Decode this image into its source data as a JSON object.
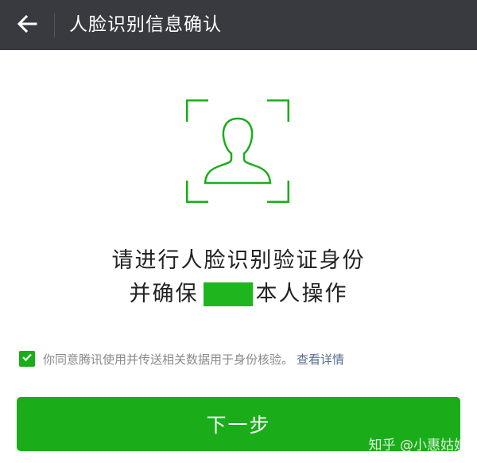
{
  "header": {
    "back_icon": "arrow-left-icon",
    "title": "人脸识别信息确认"
  },
  "illustration": {
    "icon": "face-frame-icon",
    "color": "#1aad19"
  },
  "instruction": {
    "line1": "请进行人脸识别验证身份",
    "line2_prefix": "并确保",
    "line2_suffix": "本人操作"
  },
  "agreement": {
    "checked": true,
    "text": "你同意腾讯使用并传送相关数据用于身份核验。",
    "link": "查看详情"
  },
  "button": {
    "label": "下一步",
    "color": "#1aad19"
  },
  "watermark": "知乎 @小惠姑娘"
}
